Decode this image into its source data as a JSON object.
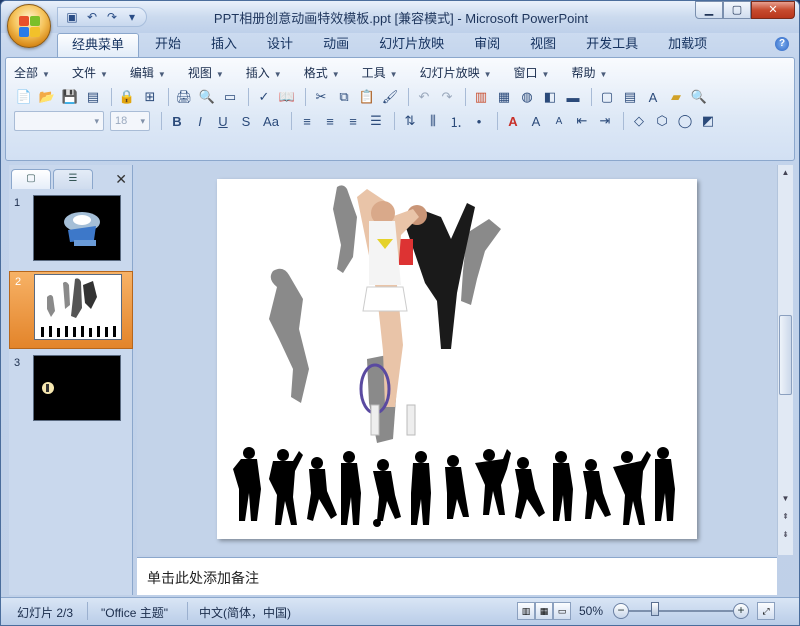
{
  "window": {
    "title": "PPT相册创意动画特效模板.ppt [兼容模式] - Microsoft PowerPoint",
    "min_label": "▁",
    "max_label": "▢",
    "close_label": "✕"
  },
  "ribbon_tabs": [
    "经典菜单",
    "开始",
    "插入",
    "设计",
    "动画",
    "幻灯片放映",
    "审阅",
    "视图",
    "开发工具",
    "加载项"
  ],
  "classic_menu": [
    "全部",
    "文件",
    "编辑",
    "视图",
    "插入",
    "格式",
    "工具",
    "幻灯片放映",
    "窗口",
    "帮助"
  ],
  "toolbar": {
    "font_size_placeholder": "18"
  },
  "slides_panel": {
    "slides": [
      {
        "number": "1"
      },
      {
        "number": "2"
      },
      {
        "number": "3"
      }
    ],
    "close_icon": "✕"
  },
  "notes": {
    "placeholder": "单击此处添加备注"
  },
  "status": {
    "slide": "幻灯片 2/3",
    "theme": "\"Office 主题\"",
    "language": "中文(简体，中国)",
    "zoom": "50%"
  },
  "colors": {
    "accent_orange": "#e3842a",
    "ribbon_blue": "#d2e0f3",
    "frame_blue": "#8ba7cc"
  }
}
